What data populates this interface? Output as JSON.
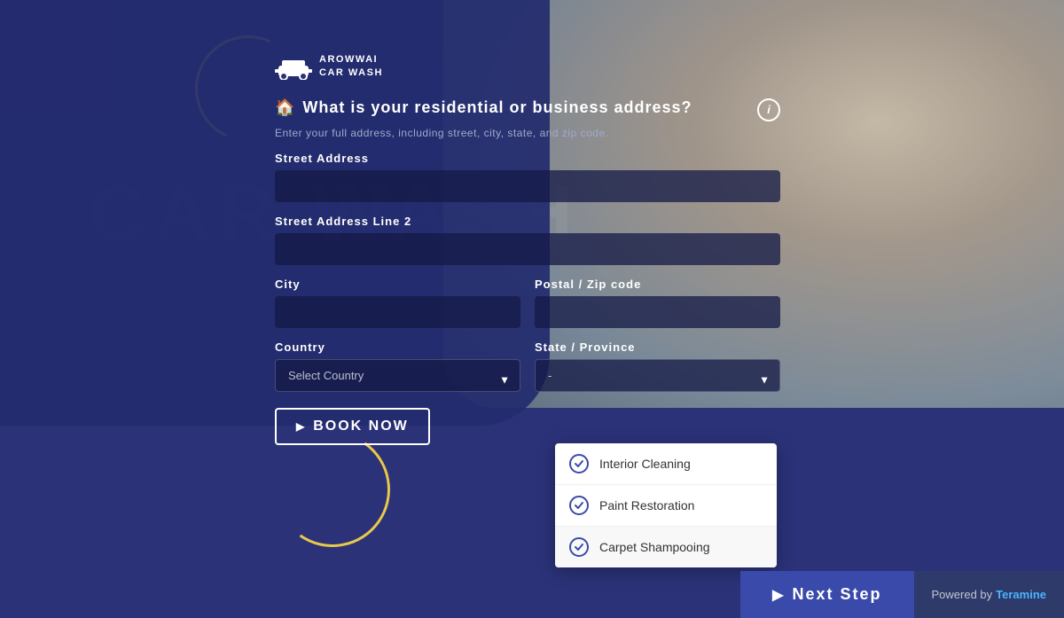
{
  "logo": {
    "line1": "AROWWAI",
    "line2": "CAR WASH"
  },
  "question": {
    "icon": "🏠",
    "title": "What is your residential or business address?",
    "subtitle": "Enter your full address, including street, city, state, and zip code.",
    "info_label": "i"
  },
  "form": {
    "street_address_label": "Street Address",
    "street_address_placeholder": "",
    "street_address2_label": "Street Address Line 2",
    "street_address2_placeholder": "",
    "city_label": "City",
    "city_placeholder": "",
    "postal_label": "Postal / Zip code",
    "postal_placeholder": "",
    "country_label": "Country",
    "country_placeholder": "Select Country",
    "state_label": "State / Province",
    "state_placeholder": "-",
    "book_now_label": "BOOK NOW"
  },
  "dropdown": {
    "items": [
      {
        "label": "Interior Cleaning",
        "checked": true
      },
      {
        "label": "Paint Restoration",
        "checked": true
      },
      {
        "label": "Carpet Shampooing",
        "checked": true
      }
    ]
  },
  "footer": {
    "next_step_label": "Next Step",
    "powered_by_prefix": "Powered by",
    "powered_by_brand": "Teramine"
  }
}
